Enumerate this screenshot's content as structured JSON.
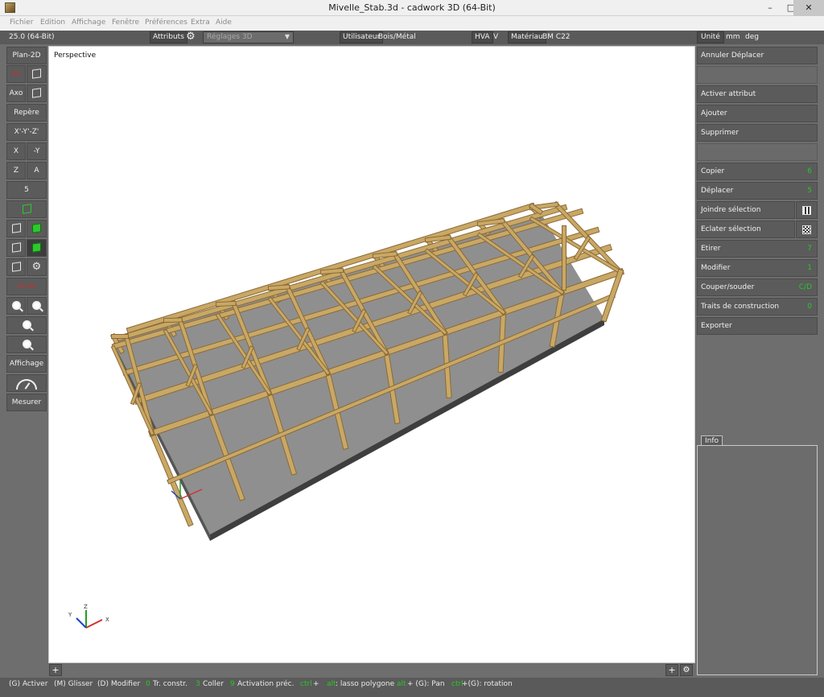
{
  "window": {
    "title": "Mivelle_Stab.3d - cadwork 3D (64-Bit)",
    "min_label": "–",
    "max_label": "□",
    "close_label": "✕"
  },
  "menu": [
    "Fichier",
    "Edition",
    "Affichage",
    "Fenêtre",
    "Préférences",
    "Extra",
    "Aide"
  ],
  "toolbar": {
    "version": "25.0 (64-Bit)",
    "attributs": "Attributs",
    "reglages": "Réglages 3D",
    "utilisateur": "Utilisateur",
    "bois_metal": "Bois/Métal",
    "hva": "HVA",
    "v": "V",
    "materiau": "Matériau",
    "materiau_value": "BM C22"
  },
  "left": {
    "plan2d": "Plan-2D",
    "iso": "Iso",
    "axo": "Axo",
    "repere": "Repère",
    "xyz": "X'-Y'-Z'",
    "x": "X",
    "neg_y": "-Y",
    "z": "Z",
    "a": "A",
    "five": "5",
    "ortho": "Ortho",
    "affichage": "Affichage",
    "mesurer": "Mesurer"
  },
  "viewport": {
    "label": "Perspective",
    "axes": {
      "x": "X",
      "y": "Y",
      "z": "Z"
    },
    "plus": "+"
  },
  "right": {
    "unite": "Unité",
    "mm": "mm",
    "deg": "deg",
    "buttons": [
      {
        "label": "Annuler Déplacer",
        "shortcut": ""
      },
      {
        "label": "Activer attribut",
        "shortcut": ""
      },
      {
        "label": "Ajouter",
        "shortcut": ""
      },
      {
        "label": "Supprimer",
        "shortcut": ""
      },
      {
        "label": "Copier",
        "shortcut": "6"
      },
      {
        "label": "Déplacer",
        "shortcut": "5"
      },
      {
        "label": "Joindre sélection",
        "shortcut": ""
      },
      {
        "label": "Eclater sélection",
        "shortcut": ""
      },
      {
        "label": "Etirer",
        "shortcut": "7"
      },
      {
        "label": "Modifier",
        "shortcut": "1"
      },
      {
        "label": "Couper/souder",
        "shortcut": "C/D"
      },
      {
        "label": "Traits de construction",
        "shortcut": "0"
      },
      {
        "label": "Exporter",
        "shortcut": ""
      }
    ],
    "info_tab": "Info"
  },
  "status": {
    "activer": "(G) Activer",
    "glisser": "(M) Glisser",
    "modifier": "(D) Modifier",
    "k0": "0",
    "trconstr": "Tr. constr.",
    "k3": "3",
    "coller": "Coller",
    "k9": "9",
    "activation": "Activation préc.",
    "ctrl": "ctrl",
    "plus": "+",
    "alt": "alt",
    "lasso": ": lasso polygone",
    "alt2": "alt",
    "pan": "+ (G): Pan",
    "ctrl2": "ctrl",
    "rotation": "+(G): rotation"
  },
  "colors": {
    "timber": "#c9a866",
    "timber_dark": "#8a6a35",
    "floor": "#8f8f8f",
    "shortcut_green": "#28c828"
  }
}
